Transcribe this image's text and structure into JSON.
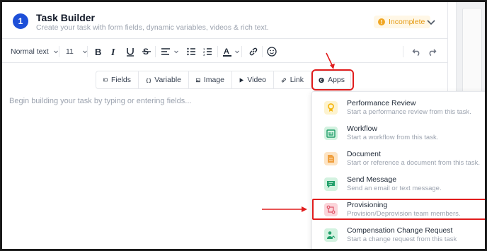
{
  "header": {
    "step": "1",
    "title": "Task Builder",
    "subtitle": "Create your task with form fields, dynamic variables, videos & rich text.",
    "status": "Incomplete"
  },
  "toolbar": {
    "paragraph_style": "Normal text",
    "font_size": "11",
    "buttons": [
      "bold-icon",
      "italic-icon",
      "underline-icon",
      "strikethrough-icon",
      "align-icon",
      "bullet-list-icon",
      "numbered-list-icon",
      "text-color-icon",
      "link-icon",
      "emoji-icon",
      "undo-icon",
      "redo-icon"
    ]
  },
  "insert_bar": {
    "items": [
      {
        "label": "Fields",
        "icon": "fields-icon"
      },
      {
        "label": "Variable",
        "icon": "variable-icon"
      },
      {
        "label": "Image",
        "icon": "image-icon"
      },
      {
        "label": "Video",
        "icon": "video-icon"
      },
      {
        "label": "Link",
        "icon": "link-icon"
      },
      {
        "label": "Apps",
        "icon": "apps-icon"
      }
    ]
  },
  "editor": {
    "placeholder": "Begin building your task by typing or entering fields..."
  },
  "apps_menu": {
    "items": [
      {
        "title": "Performance Review",
        "description": "Start a performance review from this task.",
        "icon": "award-icon",
        "color": "#f5b50a",
        "bg": "#fdf3cf"
      },
      {
        "title": "Workflow",
        "description": "Start a workflow from this task.",
        "icon": "workflow-icon",
        "color": "#22a06b",
        "bg": "#d3f2e0"
      },
      {
        "title": "Document",
        "description": "Start or reference a document from this task.",
        "icon": "document-icon",
        "color": "#f0a040",
        "bg": "#fde4c4"
      },
      {
        "title": "Send Message",
        "description": "Send an email or text message.",
        "icon": "message-icon",
        "color": "#22a06b",
        "bg": "#d3f2e0"
      },
      {
        "title": "Provisioning",
        "description": "Provision/Deprovision team members.",
        "icon": "provisioning-icon",
        "color": "#e0566a",
        "bg": "#fbd5da"
      },
      {
        "title": "Compensation Change Request",
        "description": "Start a change request from this task",
        "icon": "compensation-icon",
        "color": "#22a06b",
        "bg": "#d3f2e0"
      }
    ]
  },
  "colors": {
    "accent": "#1d4fd8",
    "annotation": "#e11d1d",
    "status": "#e49a12"
  }
}
